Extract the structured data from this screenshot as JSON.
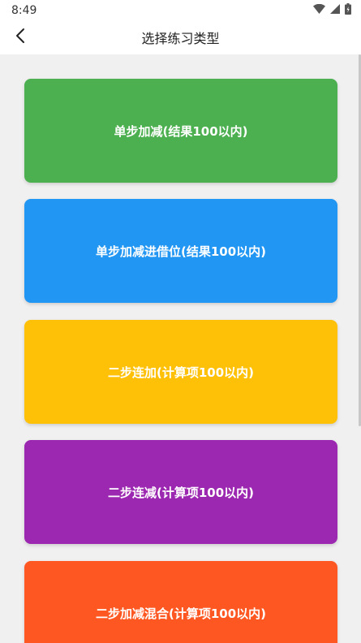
{
  "status_bar": {
    "time": "8:49",
    "icons": [
      "wifi-icon",
      "cellular-signal-icon",
      "battery-icon"
    ]
  },
  "app_bar": {
    "title": "选择练习类型",
    "back_icon": "chevron-left-icon"
  },
  "practice_types": [
    {
      "label": "单步加减(结果100以内)",
      "color": "#4caf50"
    },
    {
      "label": "单步加减进借位(结果100以内)",
      "color": "#2196f3"
    },
    {
      "label": "二步连加(计算项100以内)",
      "color": "#ffc107"
    },
    {
      "label": "二步连减(计算项100以内)",
      "color": "#9c27b0"
    },
    {
      "label": "二步加减混合(计算项100以内)",
      "color": "#ff5722"
    }
  ]
}
